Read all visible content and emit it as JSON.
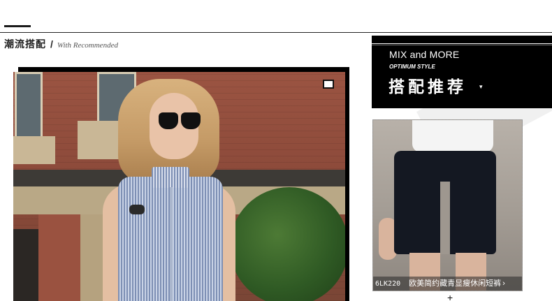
{
  "section": {
    "title_cn": "潮流搭配",
    "slash": "/",
    "title_en": "With Recommended"
  },
  "promo": {
    "line1": "MIX and MORE",
    "line2": "OPTIMUM STYLE",
    "line3": "搭配推荐",
    "caret": "▾"
  },
  "product": {
    "code": "6LK220",
    "name": "欧美简约藏青显瘦休闲短裤",
    "arrow": "›"
  },
  "icons": {
    "corner": "square-frame-icon",
    "plus": "+"
  },
  "colors": {
    "accent": "#000000",
    "background": "#ffffff"
  }
}
